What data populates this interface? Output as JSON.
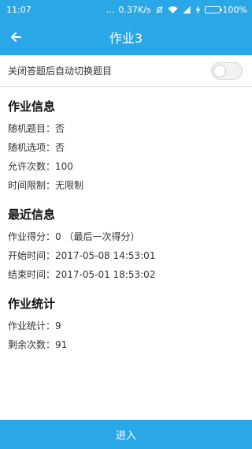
{
  "status_bar": {
    "time": "11:07",
    "dots": "...",
    "network_speed": "0.37K/s",
    "battery": "100%",
    "icons": [
      "mute-bell-icon",
      "wifi-icon",
      "signal-icon",
      "charging-icon",
      "battery-icon"
    ]
  },
  "header": {
    "title": "作业3",
    "back_icon": "arrow-left-icon"
  },
  "toggle": {
    "label": "关闭答题后自动切换题目",
    "enabled": false
  },
  "sections": {
    "homework_info": {
      "title": "作业信息",
      "rows": [
        "随机题目：否",
        "随机选项：否",
        "允许次数：100",
        "时间限制：无限制"
      ]
    },
    "recent_info": {
      "title": "最近信息",
      "rows": [
        "作业得分：0 （最后一次得分）",
        "开始时间：2017-05-08 14:53:01",
        "结束时间：2017-05-01 18:53:02"
      ]
    },
    "homework_stats": {
      "title": "作业统计",
      "rows": [
        "作业统计：9",
        "剩余次数：91"
      ]
    }
  },
  "footer": {
    "enter_label": "进入"
  },
  "colors": {
    "accent": "#2aa7e6",
    "divider": "#e2e2e2"
  }
}
